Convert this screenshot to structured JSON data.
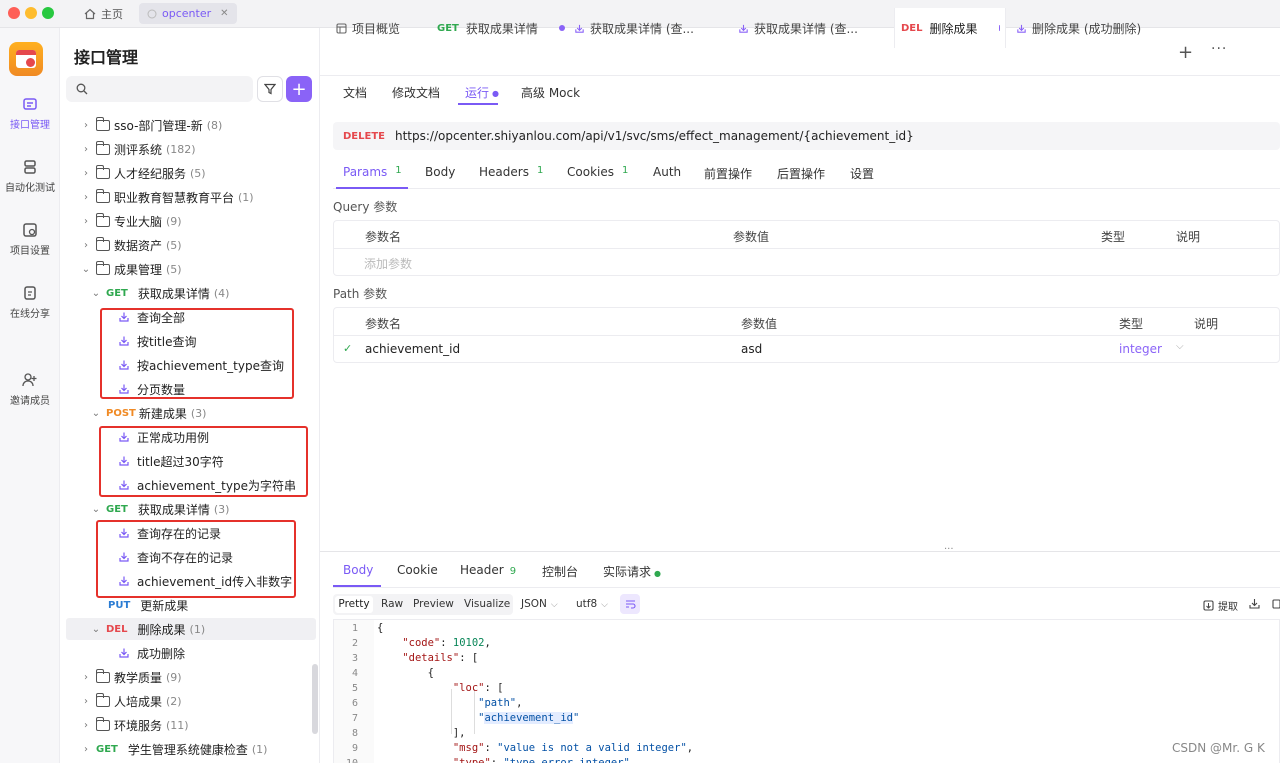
{
  "titlebar": {
    "home_tab": "主页",
    "project_tab": "opcenter"
  },
  "rail": [
    {
      "icon": "api-icon",
      "label": "接口管理",
      "active": true
    },
    {
      "icon": "automation-icon",
      "label": "自动化测试",
      "active": false
    },
    {
      "icon": "project-settings-icon",
      "label": "项目设置",
      "active": false
    },
    {
      "icon": "share-icon",
      "label": "在线分享",
      "active": false
    },
    {
      "icon": "invite-icon",
      "label": "邀请成员",
      "active": false
    }
  ],
  "sidebar": {
    "title": "接口管理",
    "search_placeholder": "",
    "tree": [
      {
        "kind": "folder",
        "label": "sso-部门管理-新",
        "count": "(8)"
      },
      {
        "kind": "folder",
        "label": "测评系统",
        "count": "(182)"
      },
      {
        "kind": "folder",
        "label": "人才经纪服务",
        "count": "(5)"
      },
      {
        "kind": "folder",
        "label": "职业教育智慧教育平台",
        "count": "(1)"
      },
      {
        "kind": "folder",
        "label": "专业大脑",
        "count": "(9)"
      },
      {
        "kind": "folder",
        "label": "数据资产",
        "count": "(5)"
      },
      {
        "kind": "folder-open",
        "label": "成果管理",
        "count": "(5)"
      },
      {
        "kind": "api",
        "method": "GET",
        "label": "获取成果详情",
        "count": "(4)"
      },
      {
        "kind": "case",
        "label": "查询全部"
      },
      {
        "kind": "case",
        "label": "按title查询"
      },
      {
        "kind": "case",
        "label": "按achievement_type查询"
      },
      {
        "kind": "case",
        "label": "分页数量"
      },
      {
        "kind": "api",
        "method": "POST",
        "label": "新建成果",
        "count": "(3)"
      },
      {
        "kind": "case",
        "label": "正常成功用例"
      },
      {
        "kind": "case",
        "label": "title超过30字符"
      },
      {
        "kind": "case",
        "label": "achievement_type为字符串"
      },
      {
        "kind": "api",
        "method": "GET",
        "label": "获取成果详情",
        "count": "(3)"
      },
      {
        "kind": "case",
        "label": "查询存在的记录"
      },
      {
        "kind": "case",
        "label": "查询不存在的记录"
      },
      {
        "kind": "case",
        "label": "achievement_id传入非数字"
      },
      {
        "kind": "api-leaf",
        "method": "PUT",
        "label": "更新成果",
        "count": ""
      },
      {
        "kind": "api",
        "method": "DEL",
        "label": "删除成果",
        "count": "(1)"
      },
      {
        "kind": "case",
        "label": "成功删除"
      },
      {
        "kind": "folder",
        "label": "教学质量",
        "count": "(9)"
      },
      {
        "kind": "folder",
        "label": "人培成果",
        "count": "(2)"
      },
      {
        "kind": "folder",
        "label": "环境服务",
        "count": "(11)"
      },
      {
        "kind": "api-root",
        "method": "GET",
        "label": "学生管理系统健康检查",
        "count": "(1)"
      }
    ]
  },
  "tabs": [
    {
      "method": "",
      "label": "项目概览"
    },
    {
      "method": "GET",
      "label": "获取成果详情"
    },
    {
      "method": "",
      "label": "获取成果详情 (查..."
    },
    {
      "method": "",
      "label": "获取成果详情 (查..."
    },
    {
      "method": "DEL",
      "label": "删除成果"
    },
    {
      "method": "",
      "label": "删除成果 (成功删除)"
    }
  ],
  "subtabs": [
    "文档",
    "修改文档",
    "运行",
    "高级 Mock"
  ],
  "request": {
    "method": "DELETE",
    "url": "https://opcenter.shiyanlou.com/api/v1/svc/sms/effect_management/{achievement_id}"
  },
  "param_tabs": [
    {
      "label": "Params",
      "count": "1"
    },
    {
      "label": "Body",
      "count": ""
    },
    {
      "label": "Headers",
      "count": "1"
    },
    {
      "label": "Cookies",
      "count": "1"
    },
    {
      "label": "Auth",
      "count": ""
    },
    {
      "label": "前置操作",
      "count": ""
    },
    {
      "label": "后置操作",
      "count": ""
    },
    {
      "label": "设置",
      "count": ""
    }
  ],
  "query": {
    "title": "Query 参数",
    "headers": [
      "参数名",
      "参数值",
      "类型",
      "说明"
    ],
    "add_placeholder": "添加参数"
  },
  "path": {
    "title": "Path 参数",
    "headers": [
      "参数名",
      "参数值",
      "类型",
      "说明"
    ],
    "row": {
      "name": "achievement_id",
      "value": "asd",
      "type": "integer"
    }
  },
  "response": {
    "tabs": [
      {
        "label": "Body",
        "count": ""
      },
      {
        "label": "Cookie",
        "count": ""
      },
      {
        "label": "Header",
        "count": "9"
      },
      {
        "label": "控制台",
        "count": ""
      },
      {
        "label": "实际请求",
        "count": ""
      }
    ],
    "format_buttons": [
      "Pretty",
      "Raw",
      "Preview",
      "Visualize"
    ],
    "format": "JSON",
    "encoding": "utf8",
    "extract_label": "提取",
    "code_lines": [
      "1",
      "2",
      "3",
      "4",
      "5",
      "6",
      "7",
      "8",
      "9",
      "10"
    ]
  },
  "watermark": "CSDN @Mr. G K"
}
